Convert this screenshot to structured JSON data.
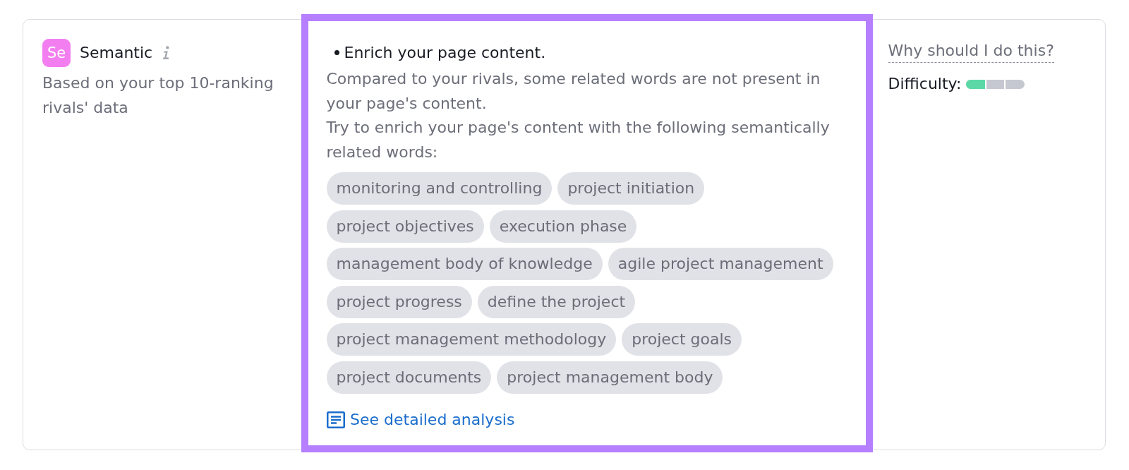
{
  "category": {
    "badge": "Se",
    "title": "Semantic",
    "subtitle": "Based on your top 10-ranking rivals' data"
  },
  "recommendation": {
    "highlighted": true,
    "heading": "Enrich your page content.",
    "paragraphs": [
      "Compared to your rivals, some related words are not present in your page's content.",
      "Try to enrich your page's content with the following semantically related words:"
    ],
    "related_words": [
      "monitoring and controlling",
      "project initiation",
      "project objectives",
      "execution phase",
      "management body of knowledge",
      "agile project management",
      "project progress",
      "define the project",
      "project management methodology",
      "project goals",
      "project documents",
      "project management body"
    ],
    "link": "See detailed analysis"
  },
  "aside": {
    "help_link": "Why should I do this?",
    "difficulty": {
      "label": "Difficulty:",
      "level": 0.33
    }
  }
}
